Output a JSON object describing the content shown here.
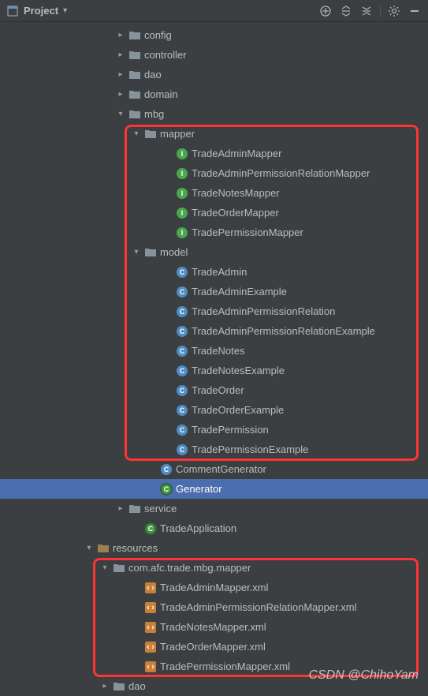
{
  "toolbar": {
    "title": "Project"
  },
  "tree": {
    "config": "config",
    "controller": "controller",
    "dao": "dao",
    "domain": "domain",
    "mbg": "mbg",
    "mapper": "mapper",
    "mapperItems": [
      "TradeAdminMapper",
      "TradeAdminPermissionRelationMapper",
      "TradeNotesMapper",
      "TradeOrderMapper",
      "TradePermissionMapper"
    ],
    "model": "model",
    "modelItems": [
      "TradeAdmin",
      "TradeAdminExample",
      "TradeAdminPermissionRelation",
      "TradeAdminPermissionRelationExample",
      "TradeNotes",
      "TradeNotesExample",
      "TradeOrder",
      "TradeOrderExample",
      "TradePermission",
      "TradePermissionExample"
    ],
    "commentGenerator": "CommentGenerator",
    "generator": "Generator",
    "service": "service",
    "tradeApplication": "TradeApplication",
    "resources": "resources",
    "mbgMapperPkg": "com.afc.trade.mbg.mapper",
    "xmlItems": [
      "TradeAdminMapper.xml",
      "TradeAdminPermissionRelationMapper.xml",
      "TradeNotesMapper.xml",
      "TradeOrderMapper.xml",
      "TradePermissionMapper.xml"
    ],
    "dao2": "dao"
  },
  "watermark": "CSDN @ChihoYam"
}
